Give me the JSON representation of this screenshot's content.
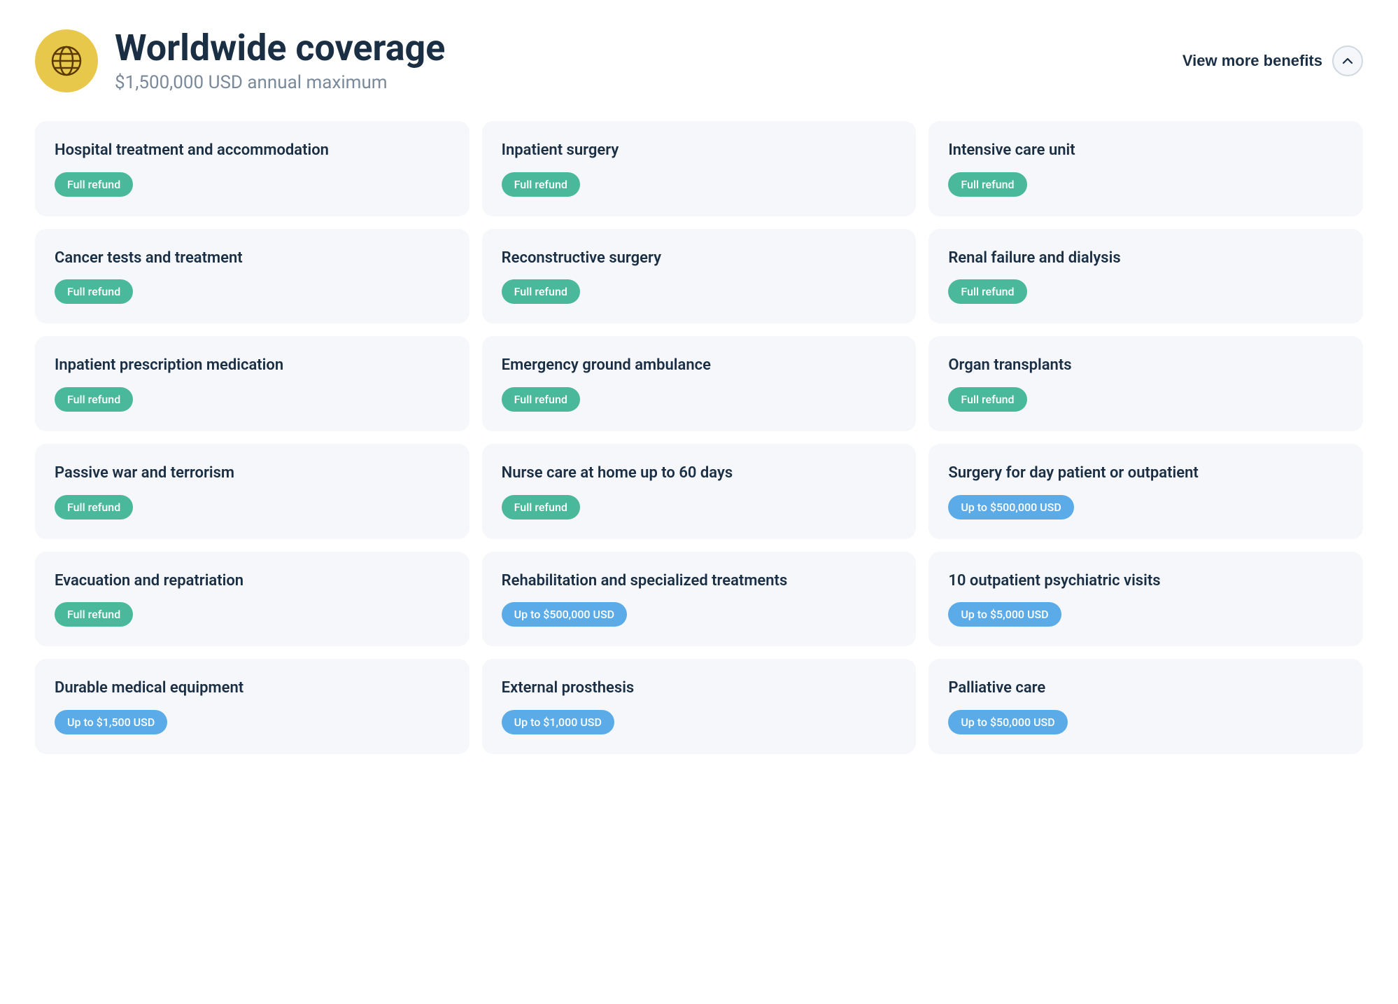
{
  "header": {
    "title": "Worldwide coverage",
    "subtitle": "$1,500,000 USD annual maximum",
    "view_more_label": "View more benefits"
  },
  "benefits": [
    {
      "title": "Hospital treatment and accommodation",
      "badge": "Full refund",
      "badge_type": "green"
    },
    {
      "title": "Inpatient surgery",
      "badge": "Full refund",
      "badge_type": "green"
    },
    {
      "title": "Intensive care unit",
      "badge": "Full refund",
      "badge_type": "green"
    },
    {
      "title": "Cancer tests and treatment",
      "badge": "Full refund",
      "badge_type": "green"
    },
    {
      "title": "Reconstructive surgery",
      "badge": "Full refund",
      "badge_type": "green"
    },
    {
      "title": "Renal failure and dialysis",
      "badge": "Full refund",
      "badge_type": "green"
    },
    {
      "title": "Inpatient prescription medication",
      "badge": "Full refund",
      "badge_type": "green"
    },
    {
      "title": "Emergency ground ambulance",
      "badge": "Full refund",
      "badge_type": "green"
    },
    {
      "title": "Organ transplants",
      "badge": "Full refund",
      "badge_type": "green"
    },
    {
      "title": "Passive war and terrorism",
      "badge": "Full refund",
      "badge_type": "green"
    },
    {
      "title": "Nurse care at home up to 60 days",
      "badge": "Full refund",
      "badge_type": "green"
    },
    {
      "title": "Surgery for day patient or outpatient",
      "badge": "Up to $500,000 USD",
      "badge_type": "blue"
    },
    {
      "title": "Evacuation and repatriation",
      "badge": "Full refund",
      "badge_type": "green"
    },
    {
      "title": "Rehabilitation and specialized treatments",
      "badge": "Up to $500,000 USD",
      "badge_type": "blue"
    },
    {
      "title": "10 outpatient psychiatric visits",
      "badge": "Up to $5,000 USD",
      "badge_type": "blue"
    },
    {
      "title": "Durable medical equipment",
      "badge": "Up to $1,500 USD",
      "badge_type": "blue"
    },
    {
      "title": "External prosthesis",
      "badge": "Up to $1,000 USD",
      "badge_type": "blue"
    },
    {
      "title": "Palliative care",
      "badge": "Up to $50,000 USD",
      "badge_type": "blue"
    }
  ]
}
